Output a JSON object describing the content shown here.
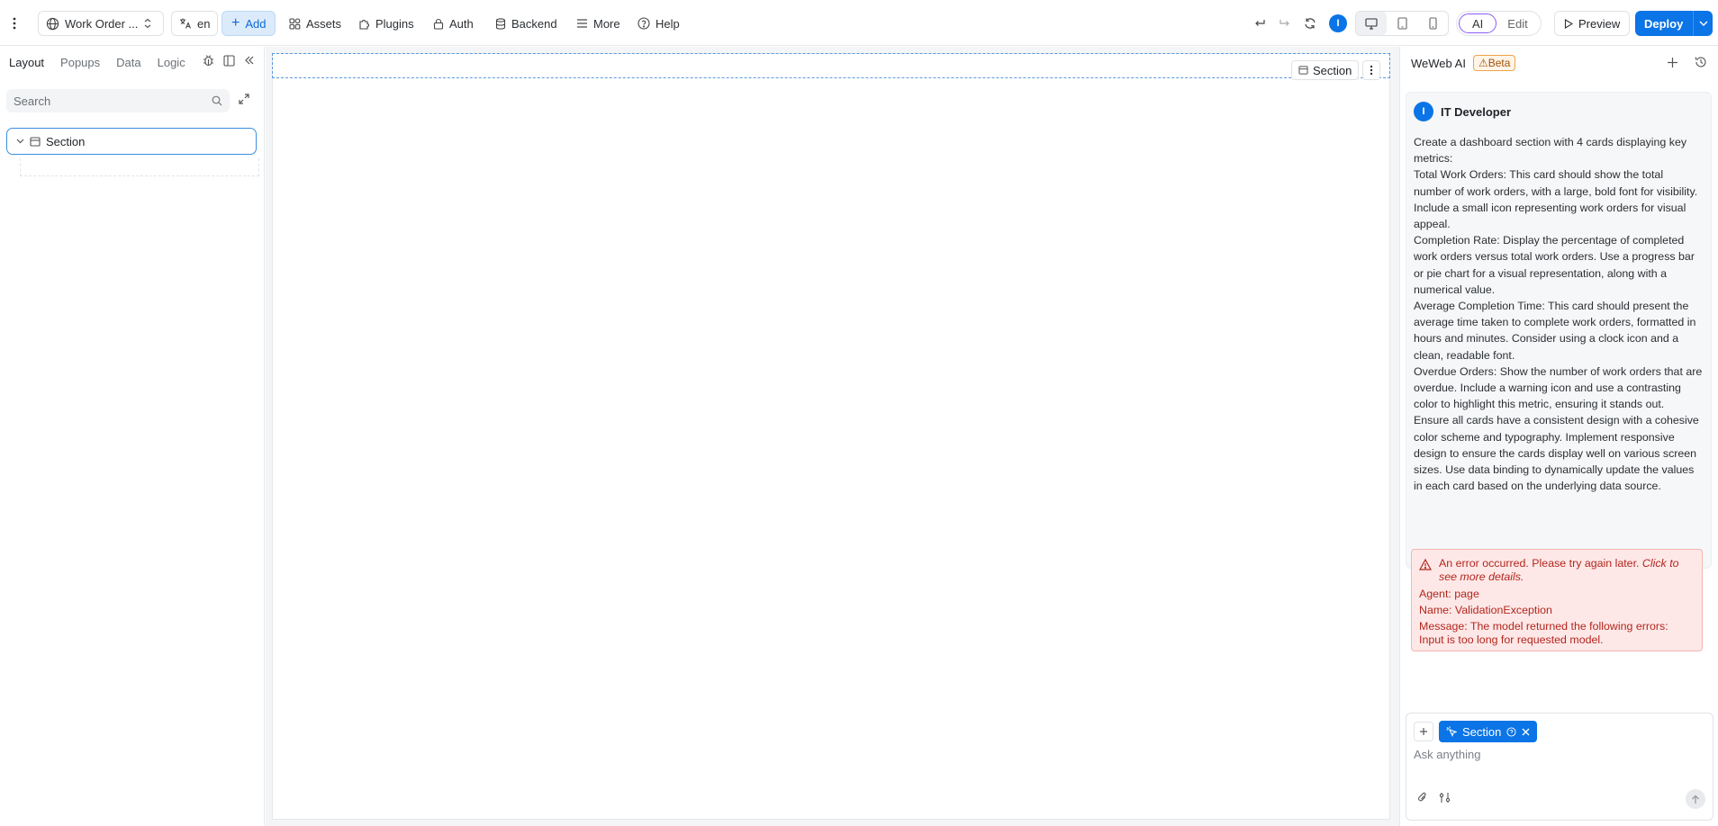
{
  "topbar": {
    "project_name": "Work Order ...",
    "language": "en",
    "add_label": "Add",
    "assets_label": "Assets",
    "plugins_label": "Plugins",
    "auth_label": "Auth",
    "backend_label": "Backend",
    "more_label": "More",
    "help_label": "Help",
    "user_initial": "I",
    "ai_label": "AI",
    "edit_label": "Edit",
    "preview_label": "Preview",
    "deploy_label": "Deploy"
  },
  "left_panel": {
    "tabs": [
      "Layout",
      "Popups",
      "Data",
      "Logic"
    ],
    "active_tab": "Layout",
    "search_placeholder": "Search",
    "tree": [
      {
        "label": "Section"
      }
    ]
  },
  "canvas": {
    "selected_label": "Section"
  },
  "ai_panel": {
    "title": "WeWeb AI",
    "badge": "Beta",
    "message": {
      "author": "IT Developer",
      "author_initial": "I",
      "paragraphs": [
        "Create a dashboard section with 4 cards displaying key metrics:",
        "Total Work Orders: This card should show the total number of work orders, with a large, bold font for visibility. Include a small icon representing work orders for visual appeal.",
        "Completion Rate: Display the percentage of completed work orders versus total work orders. Use a progress bar or pie chart for a visual representation, along with a numerical value.",
        "Average Completion Time: This card should present the average time taken to complete work orders, formatted in hours and minutes. Consider using a clock icon and a clean, readable font.",
        "Overdue Orders: Show the number of work orders that are overdue. Include a warning icon and use a contrasting color to highlight this metric, ensuring it stands out.",
        "Ensure all cards have a consistent design with a cohesive color scheme and typography. Implement responsive design to ensure the cards display well on various screen sizes. Use data binding to dynamically update the values in each card based on the underlying data source."
      ]
    },
    "error": {
      "text": "An error occurred. Please try again later.",
      "link_text": "Click to see more details.",
      "agent": "Agent: page",
      "name": "Name: ValidationException",
      "message": "Message: The model returned the following errors: Input is too long for requested model."
    },
    "composer": {
      "chip_label": "Section",
      "placeholder": "Ask anything"
    }
  },
  "colors": {
    "accent": "#0b74e6",
    "ai_outline": "#8b5cf6",
    "error_bg": "#fde8e7",
    "error_text": "#b3261e",
    "beta_border": "#f0a34a"
  }
}
